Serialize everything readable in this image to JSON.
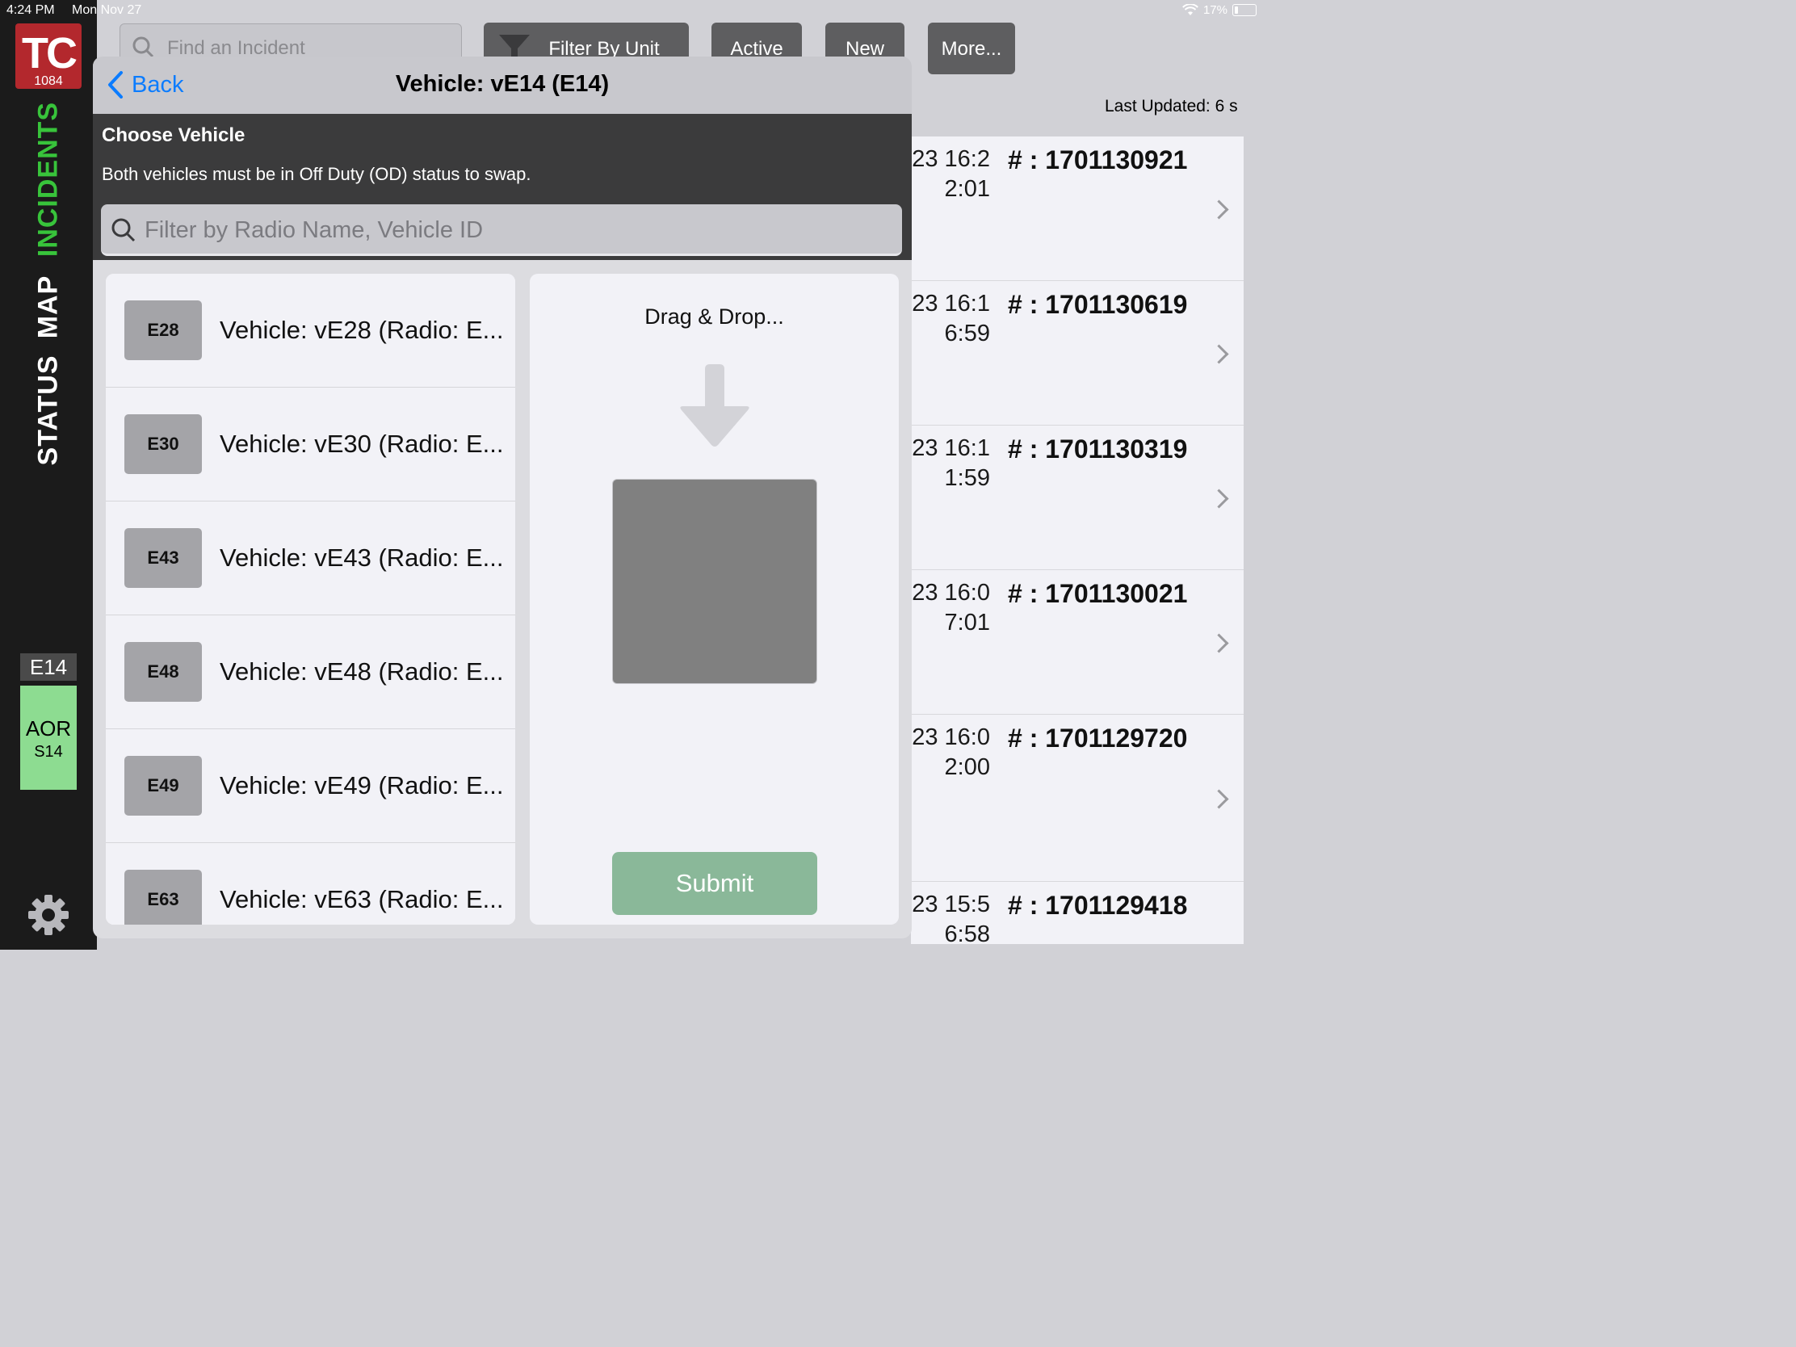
{
  "status_bar": {
    "time": "4:24 PM",
    "date": "Mon Nov 27",
    "battery": "17%"
  },
  "sidebar": {
    "logo_text": "TC",
    "logo_number": "1084",
    "nav": {
      "incidents": "INCIDENTS",
      "map": "MAP",
      "status": "STATUS"
    },
    "unit_tag": "E14",
    "unit_status": "AOR",
    "unit_station": "S14"
  },
  "toolbar": {
    "search_placeholder": "Find an Incident",
    "filter_by_unit": "Filter By Unit",
    "active": "Active",
    "new": "New",
    "more": "More..."
  },
  "last_updated": "Last Updated: 6 s",
  "incidents": [
    {
      "time": "23 16:2\n2:01",
      "number": "# : 1701130921"
    },
    {
      "time": "23 16:1\n6:59",
      "number": "# : 1701130619"
    },
    {
      "time": "23 16:1\n1:59",
      "number": "# : 1701130319"
    },
    {
      "time": "23 16:0\n7:01",
      "number": "# : 1701130021"
    },
    {
      "time": "23 16:0\n2:00",
      "number": "# : 1701129720"
    },
    {
      "time": "23 15:5\n6:58",
      "number": "# : 1701129418"
    }
  ],
  "modal": {
    "back_label": "Back",
    "title": "Vehicle: vE14 (E14)",
    "choose_title": "Choose Vehicle",
    "choose_desc": "Both vehicles must be in Off Duty (OD) status to swap.",
    "filter_placeholder": "Filter by Radio Name, Vehicle ID",
    "vehicles": [
      {
        "badge": "E28",
        "label": "Vehicle: vE28 (Radio: E..."
      },
      {
        "badge": "E30",
        "label": "Vehicle: vE30 (Radio: E..."
      },
      {
        "badge": "E43",
        "label": "Vehicle: vE43 (Radio: E..."
      },
      {
        "badge": "E48",
        "label": "Vehicle: vE48 (Radio: E..."
      },
      {
        "badge": "E49",
        "label": "Vehicle: vE49 (Radio: E..."
      },
      {
        "badge": "E63",
        "label": "Vehicle: vE63 (Radio: E..."
      }
    ],
    "drop_title": "Drag & Drop...",
    "submit_label": "Submit"
  },
  "colors": {
    "sidebar_bg": "#1b1b1b",
    "logo_red": "#b3282d",
    "nav_active": "#38c43b",
    "unit_card": "#8ddc91",
    "link_blue": "#0b7cff",
    "submit_green": "#8ab899"
  }
}
